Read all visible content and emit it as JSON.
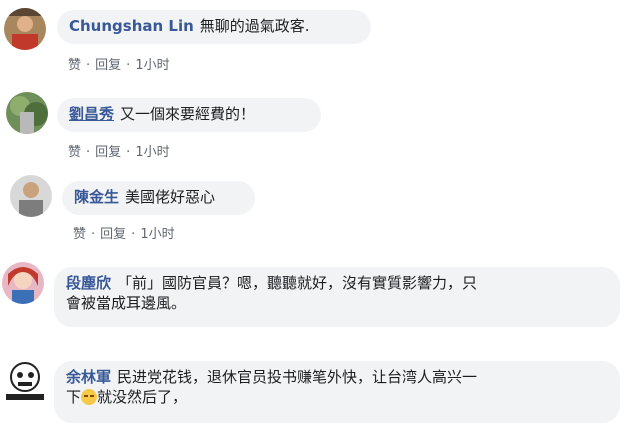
{
  "comments": [
    {
      "author": "Chungshan Lin",
      "text": "無聊的過氣政客.",
      "actions": {
        "like": "赞",
        "reply": "回复",
        "time": "1小时"
      }
    },
    {
      "author": "劉昌秀",
      "text": "又一個來要經費的！",
      "actions": {
        "like": "赞",
        "reply": "回复",
        "time": "1小时"
      }
    },
    {
      "author": "陳金生",
      "text": "美國佬好惡心",
      "actions": {
        "like": "赞",
        "reply": "回复",
        "time": "1小时"
      }
    },
    {
      "author": "段塵欣",
      "text_line1": "「前」國防官員？嗯，聽聽就好，沒有實質影響力，只",
      "text_line2": "會被當成耳邊風。"
    },
    {
      "author": "余林軍",
      "text_line1": "民进党花钱，退休官员投书赚笔外快，让台湾人高兴一",
      "text_line2a": "下",
      "text_line2b": "就没然后了，",
      "emoji": "disappointed-face-emoji"
    }
  ],
  "separator": "·",
  "colors": {
    "author": "#385898",
    "bubble": "#f2f3f5",
    "meta": "#606770"
  }
}
